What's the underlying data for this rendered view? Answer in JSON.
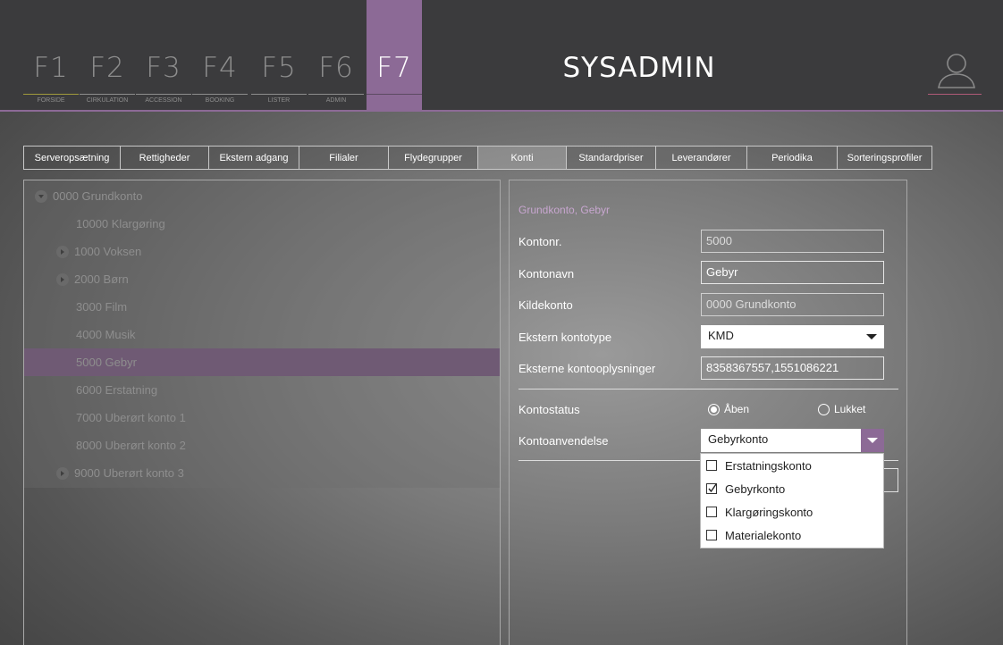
{
  "header": {
    "fkeys": [
      {
        "key": "F1",
        "label": "FORSIDE"
      },
      {
        "key": "F2",
        "label": "CIRKULATION"
      },
      {
        "key": "F3",
        "label": "ACCESSION"
      },
      {
        "key": "F4",
        "label": "BOOKING"
      },
      {
        "key": "F5",
        "label": "LISTER"
      },
      {
        "key": "F6",
        "label": "ADMIN"
      },
      {
        "key": "F7",
        "label": ""
      }
    ],
    "active_key": "F7",
    "title": "SYSADMIN",
    "accent_color": "#8c6a96"
  },
  "tabs": [
    {
      "label": "Serveropsætning"
    },
    {
      "label": "Rettigheder"
    },
    {
      "label": "Ekstern adgang"
    },
    {
      "label": "Filialer"
    },
    {
      "label": "Flydegrupper"
    },
    {
      "label": "Konti",
      "active": true
    },
    {
      "label": "Standardpriser"
    },
    {
      "label": "Leverandører"
    },
    {
      "label": "Periodika"
    },
    {
      "label": "Sorteringsprofiler"
    }
  ],
  "tree": {
    "items": [
      {
        "label": "0000 Grundkonto",
        "expander": "expanded"
      },
      {
        "label": "10000 Klargøring",
        "expander": "none"
      },
      {
        "label": "1000 Voksen",
        "expander": "collapsed"
      },
      {
        "label": "2000 Børn",
        "expander": "collapsed"
      },
      {
        "label": "3000 Film",
        "expander": "none"
      },
      {
        "label": "4000 Musik",
        "expander": "none"
      },
      {
        "label": "5000 Gebyr",
        "expander": "none",
        "selected": true
      },
      {
        "label": "6000 Erstatning",
        "expander": "none"
      },
      {
        "label": "7000 Uberørt konto 1",
        "expander": "none"
      },
      {
        "label": "8000 Uberørt konto 2",
        "expander": "none"
      },
      {
        "label": "9000 Uberørt konto 3",
        "expander": "collapsed"
      }
    ]
  },
  "detail": {
    "title": "Grundkonto, Gebyr",
    "kontonr": {
      "label": "Kontonr.",
      "value": "5000"
    },
    "kontonavn": {
      "label": "Kontonavn",
      "value": "Gebyr"
    },
    "kildekonto": {
      "label": "Kildekonto",
      "value": "0000 Grundkonto"
    },
    "ekstern_kontotype": {
      "label": "Ekstern kontotype",
      "value": "KMD"
    },
    "eksterne_kontooplysninger": {
      "label": "Eksterne kontooplysninger",
      "value": "8358367557,1551086221"
    },
    "kontostatus": {
      "label": "Kontostatus",
      "options": [
        "Åben",
        "Lukket"
      ],
      "selected": "Åben"
    },
    "kontoanvendelse": {
      "label": "Kontoanvendelse",
      "value": "Gebyrkonto",
      "options": [
        {
          "label": "Erstatningskonto",
          "checked": false
        },
        {
          "label": "Gebyrkonto",
          "checked": true
        },
        {
          "label": "Klargøringskonto",
          "checked": false
        },
        {
          "label": "Materialekonto",
          "checked": false
        }
      ]
    }
  }
}
